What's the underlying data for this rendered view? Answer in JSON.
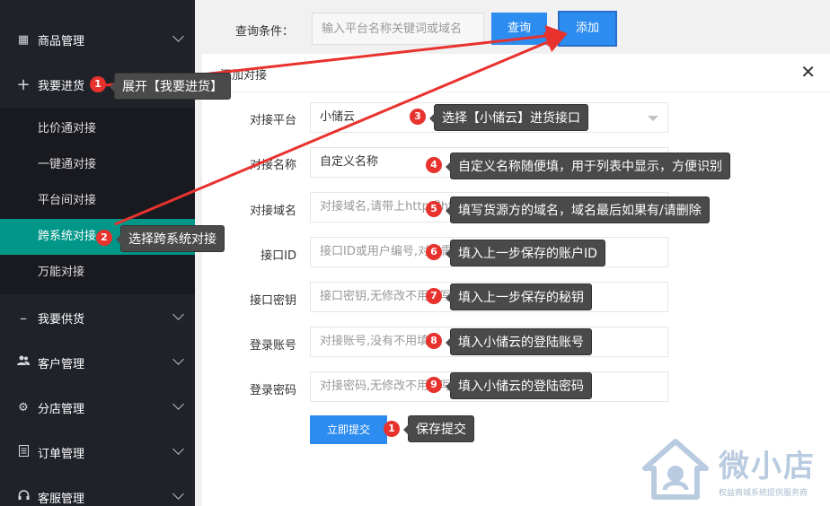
{
  "sidebar": {
    "items": [
      {
        "label": "商品管理",
        "icon": "grid-icon"
      },
      {
        "label": "我要进货",
        "icon": "plus-icon"
      },
      {
        "label": "我要供货",
        "icon": "minus-icon"
      },
      {
        "label": "客户管理",
        "icon": "users-icon"
      },
      {
        "label": "分店管理",
        "icon": "gear-icon"
      },
      {
        "label": "订单管理",
        "icon": "document-icon"
      },
      {
        "label": "客服管理",
        "icon": "headset-icon"
      }
    ],
    "sub_items": [
      "比价通对接",
      "一键通对接",
      "平台间对接",
      "跨系统对接",
      "万能对接"
    ]
  },
  "topbar": {
    "query_label": "查询条件：",
    "search_placeholder": "输入平台名称关键词或域名",
    "search_button": "查询",
    "add_button": "添加"
  },
  "modal": {
    "title": "添加对接",
    "close": "✕",
    "fields": [
      {
        "label": "对接平台",
        "value": "小储云",
        "placeholder": ""
      },
      {
        "label": "对接名称",
        "value": "自定义名称",
        "placeholder": ""
      },
      {
        "label": "对接域名",
        "value": "",
        "placeholder": "对接域名,请带上http或https"
      },
      {
        "label": "接口ID",
        "value": "",
        "placeholder": "接口ID或用户编号,对接需要填写"
      },
      {
        "label": "接口密钥",
        "value": "",
        "placeholder": "接口密钥,无修改不用填写"
      },
      {
        "label": "登录账号",
        "value": "",
        "placeholder": "对接账号,没有不用填写"
      },
      {
        "label": "登录密码",
        "value": "",
        "placeholder": "对接密码,无修改不用填写"
      }
    ],
    "submit": "立即提交"
  },
  "annotations": [
    {
      "badge": "1",
      "text": "展开【我要进货】"
    },
    {
      "badge": "2",
      "text": "选择跨系统对接"
    },
    {
      "badge": "3",
      "text": "选择【小储云】进货接口"
    },
    {
      "badge": "4",
      "text": "自定义名称随便填，用于列表中显示，方便识别"
    },
    {
      "badge": "5",
      "text": "填写货源方的域名，域名最后如果有/请删除"
    },
    {
      "badge": "6",
      "text": "填入上一步保存的账户ID"
    },
    {
      "badge": "7",
      "text": "填入上一步保存的秘钥"
    },
    {
      "badge": "8",
      "text": "填入小储云的登陆账号"
    },
    {
      "badge": "9",
      "text": "填入小储云的登陆密码"
    },
    {
      "badge": "1",
      "text": "保存提交"
    }
  ],
  "watermark": {
    "name": "微小店",
    "tagline": "权益商城系统提供服务商"
  },
  "colors": {
    "sidebar_bg": "#20222a",
    "active_teal": "#009688",
    "button_blue": "#2d8cf0",
    "badge_red": "#e8322e",
    "arrow_red": "#e8322e"
  }
}
